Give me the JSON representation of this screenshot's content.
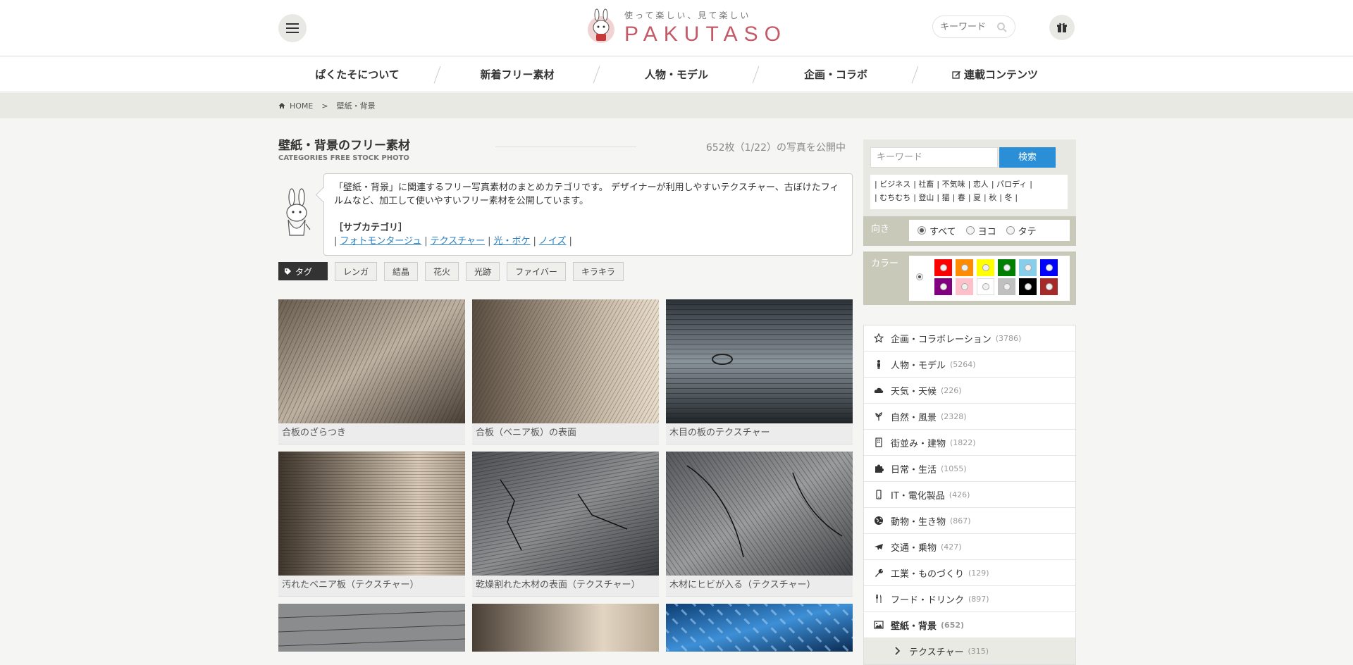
{
  "header": {
    "logo_tagline": "使って楽しい、見て楽しい",
    "logo_word": "PAKUTASO",
    "search_placeholder": "キーワード"
  },
  "nav": {
    "items": [
      {
        "label": "ぱくたそについて"
      },
      {
        "label": "新着フリー素材"
      },
      {
        "label": "人物・モデル"
      },
      {
        "label": "企画・コラボ"
      },
      {
        "label": "連載コンテンツ",
        "icon": "edit-icon"
      }
    ]
  },
  "breadcrumb": {
    "home": "HOME",
    "separator": ">",
    "current": "壁紙・背景"
  },
  "main": {
    "title": "壁紙・背景のフリー素材",
    "subtitle": "CATEGORIES FREE STOCK PHOTO",
    "count_text": "652枚（1/22）の写真を公開中",
    "description": "「壁紙・背景」に関連するフリー写真素材のまとめカテゴリです。 デザイナーが利用しやすいテクスチャー、古ぼけたフィルムなど、加工して使いやすいフリー素材を公開しています。",
    "subcategory_heading": "［サブカテゴリ］",
    "subcategory_links": [
      "フォトモンタージュ",
      "テクスチャー",
      "光・ボケ",
      "ノイズ"
    ],
    "tag_label": "タグ",
    "tags": [
      "レンガ",
      "結晶",
      "花火",
      "光跡",
      "ファイバー",
      "キラキラ"
    ],
    "photos": [
      {
        "caption": "合板のざらつき"
      },
      {
        "caption": "合板（ベニア板）の表面"
      },
      {
        "caption": "木目の板のテクスチャー"
      },
      {
        "caption": "汚れたベニア板（テクスチャー）"
      },
      {
        "caption": "乾燥割れた木材の表面（テクスチャー）"
      },
      {
        "caption": "木材にヒビが入る（テクスチャー）"
      },
      {
        "caption": ""
      },
      {
        "caption": ""
      },
      {
        "caption": ""
      }
    ]
  },
  "sidebar": {
    "search_placeholder": "キーワード",
    "search_button": "検索",
    "keywords": [
      "ビジネス",
      "社畜",
      "不気味",
      "恋人",
      "パロディ",
      "むちむち",
      "登山",
      "猫",
      "春",
      "夏",
      "秋",
      "冬"
    ],
    "orientation_label": "向き",
    "orientation_options": [
      {
        "label": "すべて",
        "selected": true
      },
      {
        "label": "ヨコ",
        "selected": false
      },
      {
        "label": "タテ",
        "selected": false
      }
    ],
    "color_label": "カラー",
    "colors": [
      "#ff0000",
      "#ff8c00",
      "#ffff00",
      "#008000",
      "#87ceeb",
      "#0000ff",
      "#800080",
      "#ffc0cb",
      "#ffffff",
      "#c0c0c0",
      "#000000",
      "#a52a2a"
    ],
    "categories": [
      {
        "label": "企画・コラボレーション",
        "count": "(3786)",
        "icon": "star-icon"
      },
      {
        "label": "人物・モデル",
        "count": "(5264)",
        "icon": "person-icon"
      },
      {
        "label": "天気・天候",
        "count": "(226)",
        "icon": "cloud-icon"
      },
      {
        "label": "自然・風景",
        "count": "(2328)",
        "icon": "leaf-icon"
      },
      {
        "label": "街並み・建物",
        "count": "(1822)",
        "icon": "building-icon"
      },
      {
        "label": "日常・生活",
        "count": "(1055)",
        "icon": "puzzle-icon"
      },
      {
        "label": "IT・電化製品",
        "count": "(426)",
        "icon": "mobile-icon"
      },
      {
        "label": "動物・生き物",
        "count": "(867)",
        "icon": "globe-icon"
      },
      {
        "label": "交通・乗物",
        "count": "(427)",
        "icon": "plane-icon"
      },
      {
        "label": "工業・ものづくり",
        "count": "(129)",
        "icon": "wrench-icon"
      },
      {
        "label": "フード・ドリンク",
        "count": "(897)",
        "icon": "cutlery-icon"
      },
      {
        "label": "壁紙・背景",
        "count": "(652)",
        "icon": "image-icon",
        "active": true
      },
      {
        "label": "テクスチャー",
        "count": "(315)",
        "icon": "chevron-right-icon",
        "sub": true
      }
    ]
  }
}
